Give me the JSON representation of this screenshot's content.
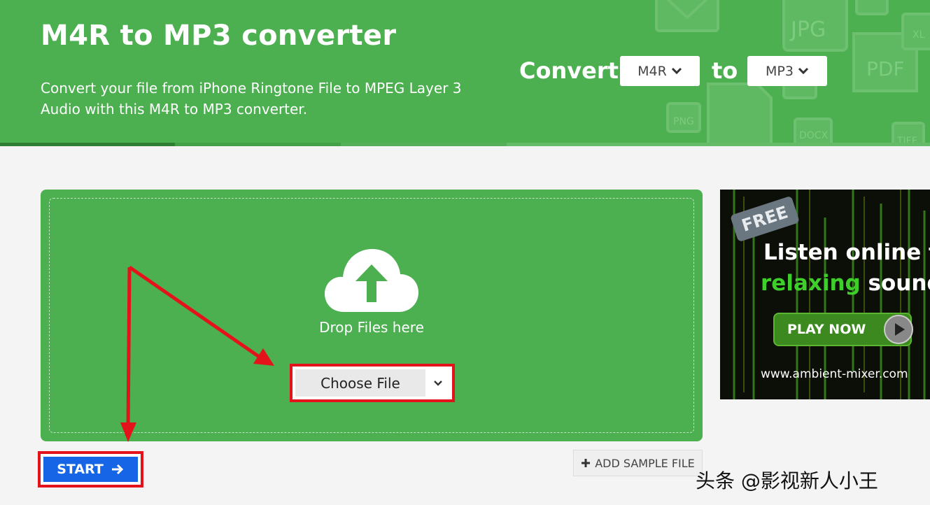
{
  "header": {
    "title": "M4R to MP3 converter",
    "subtitle": "Convert your file from iPhone Ringtone File to MPEG Layer 3 Audio with this M4R to MP3 converter.",
    "convert_label": "Convert",
    "to_label": "to",
    "from_format": "M4R",
    "to_format": "MP3",
    "bg_icons": [
      "JPG",
      "PDF",
      "PNG",
      "DOCX",
      "XL",
      "TIFF"
    ]
  },
  "upload": {
    "drop_text": "Drop Files here",
    "choose_file_label": "Choose File"
  },
  "actions": {
    "start_label": "START",
    "add_sample_label": "ADD SAMPLE FILE"
  },
  "ad": {
    "badge": "FREE",
    "line1": "Listen online to",
    "line2_green": "relaxing",
    "line2_rest": " sounds",
    "play_label": "PLAY NOW",
    "url": "www.ambient-mixer.com"
  },
  "watermark": "头条 @影视新人小王",
  "colors": {
    "brand_green": "#4caf50",
    "start_blue": "#1565e6",
    "annotation_red": "#e4121a"
  }
}
